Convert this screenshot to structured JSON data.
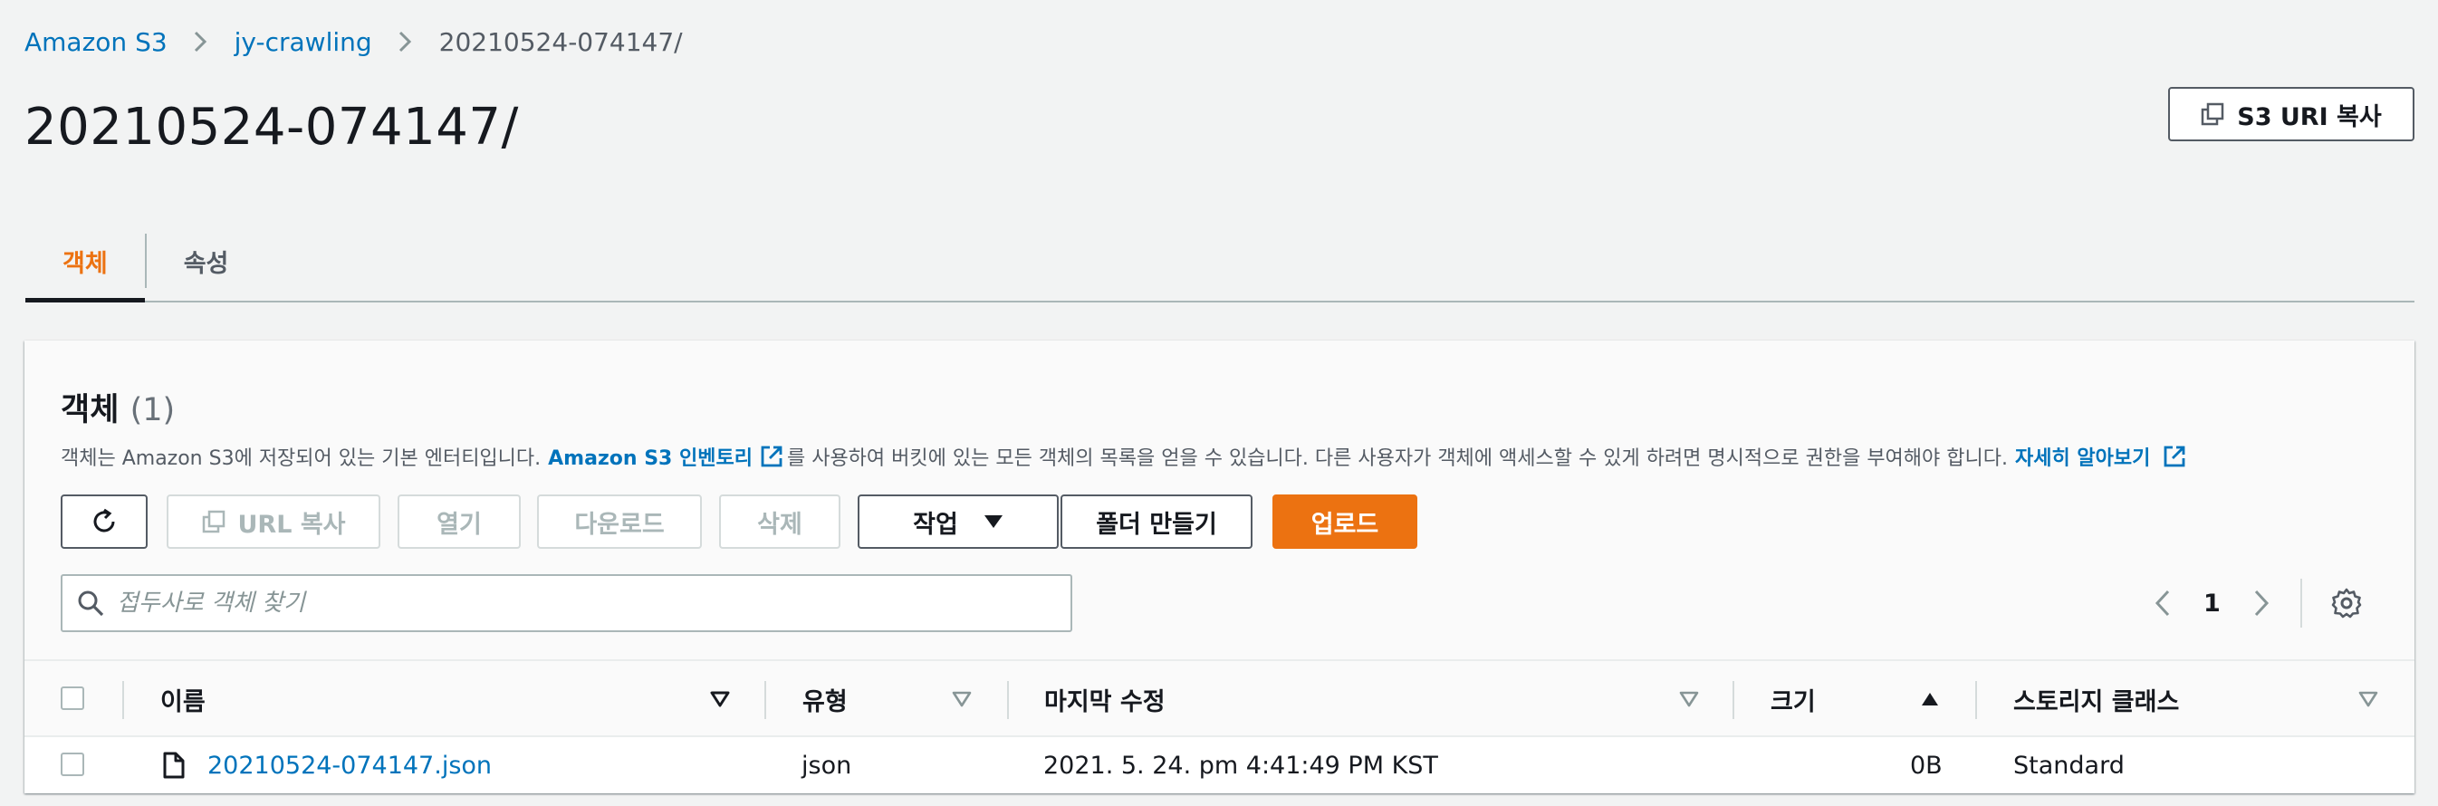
{
  "breadcrumb": {
    "items": [
      "Amazon S3",
      "jy-crawling"
    ],
    "current": "20210524-074147/"
  },
  "page_title": "20210524-074147/",
  "copy_uri_label": "S3 URI 복사",
  "tabs": [
    {
      "label": "객체",
      "active": true
    },
    {
      "label": "속성",
      "active": false
    }
  ],
  "panel": {
    "title": "객체",
    "count": "(1)",
    "desc_prefix": "객체는 Amazon S3에 저장되어 있는 기본 엔터티입니다.",
    "inventory_link": "Amazon S3 인벤토리",
    "desc_middle": "를 사용하여 버킷에 있는 모든 객체의 목록을 얻을 수 있습니다. 다른 사용자가 객체에 액세스할 수 있게 하려면 명시적으로 권한을 부여해야 합니다.",
    "learn_more": "자세히 알아보기"
  },
  "toolbar": {
    "copy_url": "URL 복사",
    "open": "열기",
    "download": "다운로드",
    "delete": "삭제",
    "actions": "작업",
    "create_folder": "폴더 만들기",
    "upload": "업로드"
  },
  "search": {
    "placeholder": "접두사로 객체 찾기"
  },
  "pagination": {
    "page": "1"
  },
  "table": {
    "columns": {
      "name": "이름",
      "type": "유형",
      "modified": "마지막 수정",
      "size": "크기",
      "storage": "스토리지 클래스"
    },
    "rows": [
      {
        "name": "20210524-074147.json",
        "type": "json",
        "modified": "2021. 5. 24. pm 4:41:49 PM KST",
        "size": "0B",
        "storage": "Standard"
      }
    ]
  },
  "colors": {
    "accent": "#ec7211",
    "link": "#0073bb",
    "text": "#16191f",
    "background": "#f2f3f3"
  },
  "icons": [
    "chevron-right-icon",
    "copy-icon",
    "refresh-icon",
    "external-link-icon",
    "caret-down-icon",
    "search-icon",
    "chevron-left-icon",
    "gear-icon",
    "file-icon",
    "sort-down-icon",
    "sort-up-icon"
  ]
}
